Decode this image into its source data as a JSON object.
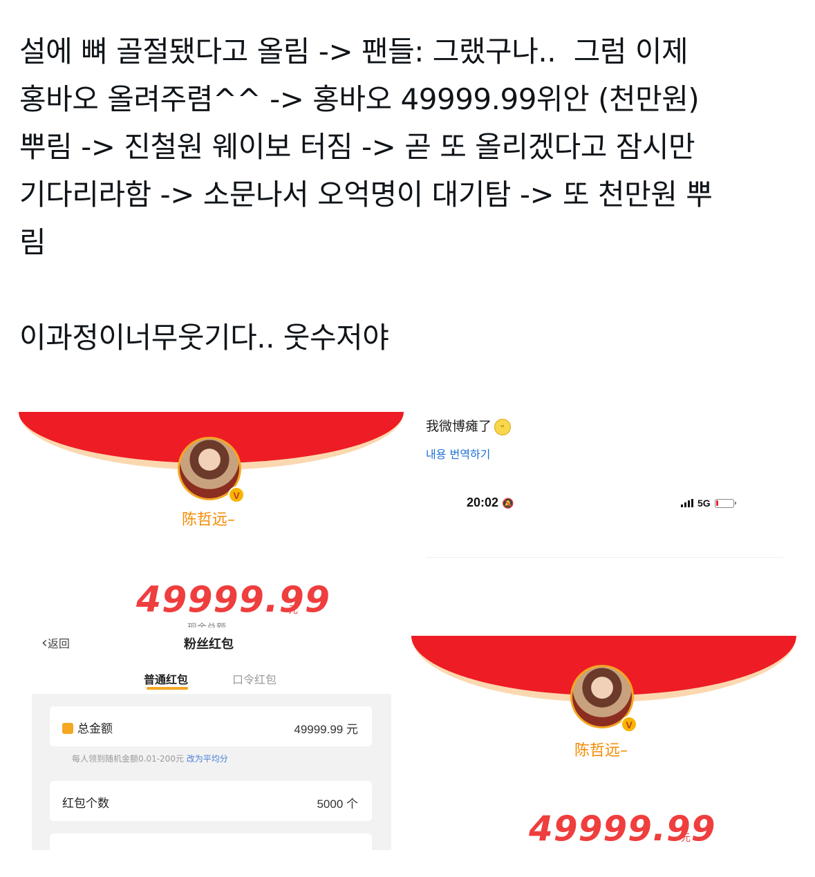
{
  "tweet": {
    "lines": [
      "설에 뼈 골절됐다고 올림 -> 팬들: 그랬구나..  그럼 이제",
      "홍바오 올려주렴^^ -> 홍바오 49999.99위안 (천만원)",
      "뿌림 -> 진철원 웨이보 터짐 -> 곧 또 올리겠다고 잠시만",
      "기다리라함 -> 소문나서 오억명이 대기탐 -> 또 천만원 뿌",
      "림"
    ],
    "closing": "이과정이너무웃기다.. 웃수저야"
  },
  "red_packet_top": {
    "name": "陈哲远–",
    "amount": "49999.99",
    "unit": "元",
    "cut_label": "现金总额"
  },
  "weibo_post": {
    "text": "我微博瘫了",
    "emoji": "smile-emoji",
    "translate": "내용 번역하기",
    "status_time": "20:02",
    "network": "5G"
  },
  "red_packet_bottom": {
    "name": "陈哲远–",
    "amount": "49999.99",
    "unit": "元"
  },
  "form": {
    "back": "返回",
    "title": "粉丝红包",
    "tabs": [
      "普通红包",
      "口令红包"
    ],
    "total_label": "总金额",
    "total_value": "49999.99 元",
    "hint": "每人领到随机金额0.01-200元",
    "hint_link": "改为平均分",
    "count_label": "红包个数",
    "count_value": "5000 个"
  },
  "colors": {
    "red": "#ee1c24",
    "peach": "#fbd8b0",
    "amount": "#ef3e3e",
    "name": "#f58a00",
    "accent": "#f5a623"
  }
}
